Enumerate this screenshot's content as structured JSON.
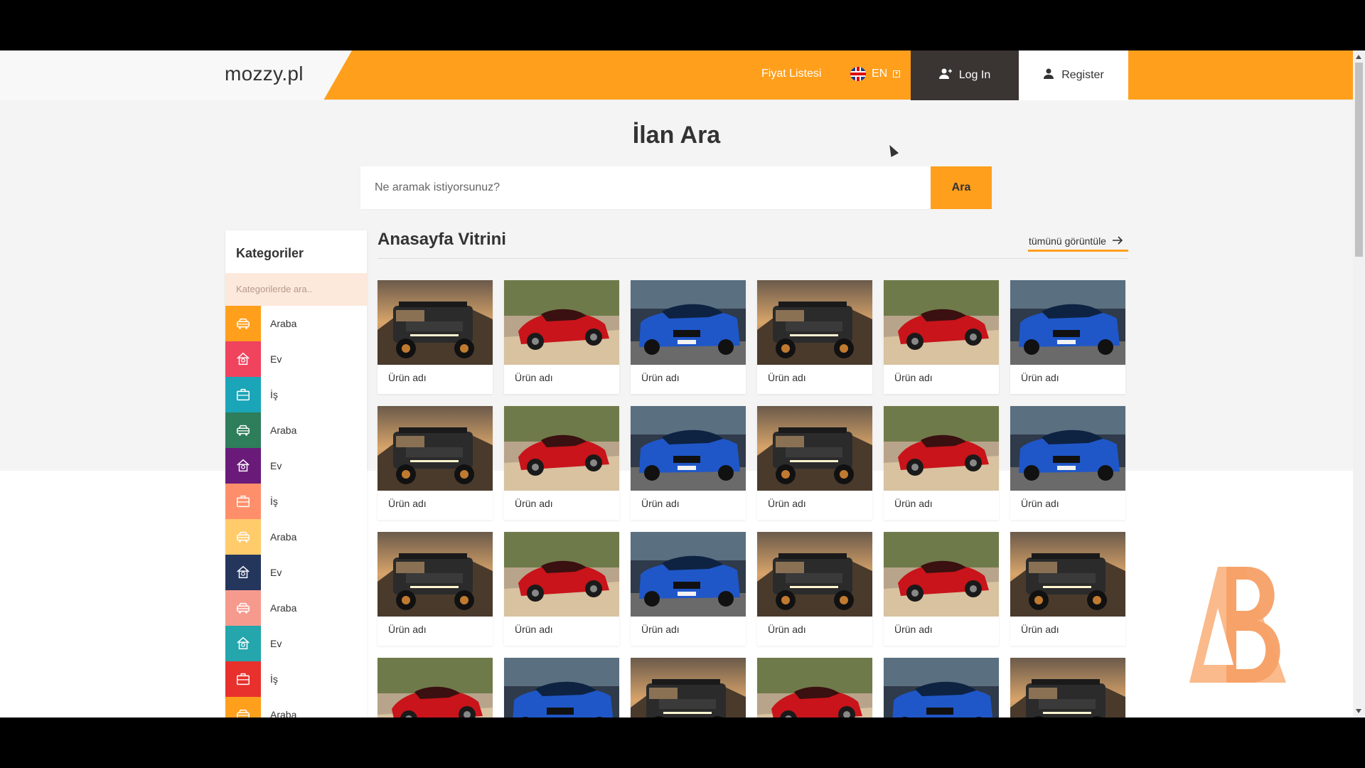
{
  "brand": "mozzy.pl",
  "nav": {
    "price_list": "Fiyat Listesi",
    "lang": "EN",
    "login": "Log In",
    "register": "Register"
  },
  "search": {
    "title": "İlan Ara",
    "placeholder": "Ne aramak istiyorsunuz?",
    "button": "Ara"
  },
  "sidebar": {
    "title": "Kategoriler",
    "search_placeholder": "Kategorilerde ara..",
    "items": [
      {
        "label": "Araba",
        "icon": "car-icon",
        "color": "#ff9f1c"
      },
      {
        "label": "Ev",
        "icon": "house-icon",
        "color": "#f0435e"
      },
      {
        "label": "İş",
        "icon": "briefcase-icon",
        "color": "#1aa5b8"
      },
      {
        "label": "Araba",
        "icon": "car-icon",
        "color": "#2e7d5b"
      },
      {
        "label": "Ev",
        "icon": "house-icon",
        "color": "#6a1b7a"
      },
      {
        "label": "İş",
        "icon": "briefcase-icon",
        "color": "#ff8f6b"
      },
      {
        "label": "Araba",
        "icon": "car-icon",
        "color": "#ffcb6b"
      },
      {
        "label": "Ev",
        "icon": "house-icon",
        "color": "#25365d"
      },
      {
        "label": "Araba",
        "icon": "car-icon",
        "color": "#f79a8e"
      },
      {
        "label": "Ev",
        "icon": "house-icon",
        "color": "#24a6ac"
      },
      {
        "label": "İş",
        "icon": "briefcase-icon",
        "color": "#e8312d"
      },
      {
        "label": "Araba",
        "icon": "car-icon",
        "color": "#ff9f1c"
      }
    ]
  },
  "showcase": {
    "title": "Anasayfa Vitrini",
    "view_all": "tümünü görüntüle",
    "product_label": "Ürün adı",
    "rows": [
      [
        "truck",
        "red",
        "blue",
        "truck",
        "red",
        "blue"
      ],
      [
        "truck",
        "red",
        "blue",
        "truck",
        "red",
        "blue"
      ],
      [
        "truck",
        "red",
        "blue",
        "truck",
        "red",
        "truck"
      ],
      [
        "red",
        "blue",
        "truck",
        "red",
        "blue",
        "truck"
      ]
    ]
  },
  "colors": {
    "accent": "#ff9f1c",
    "dark": "#3a3533"
  }
}
